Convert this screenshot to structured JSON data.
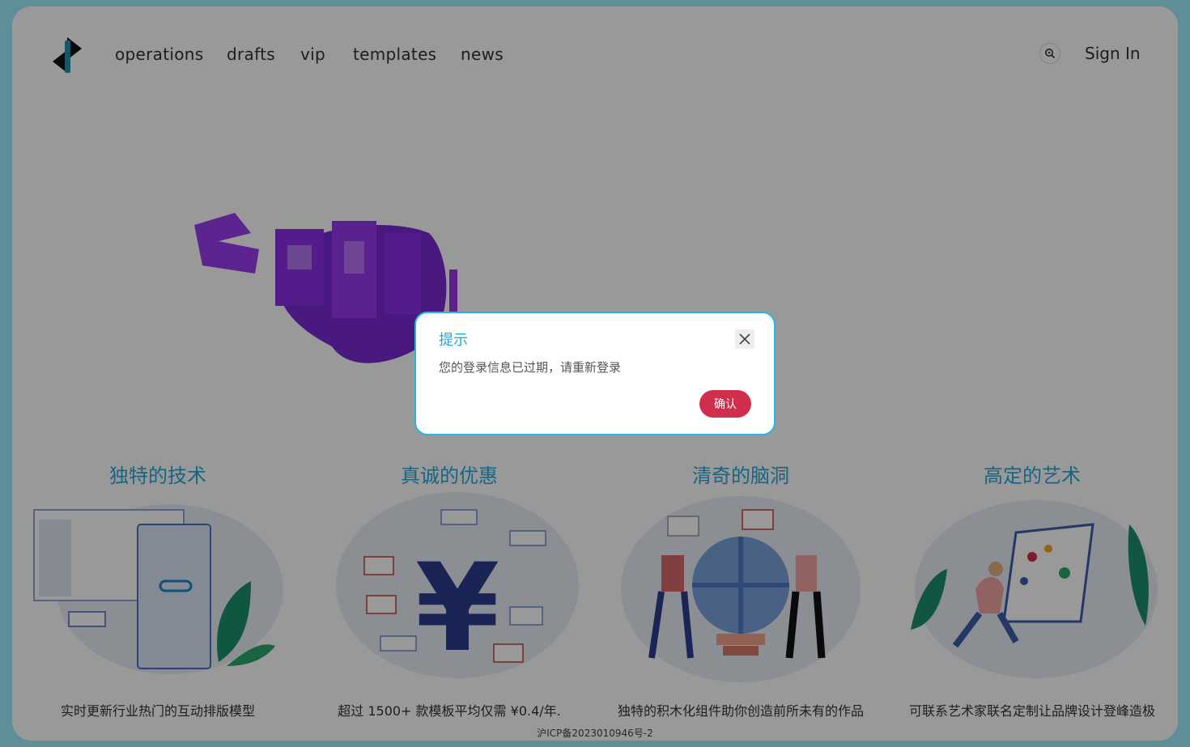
{
  "nav": {
    "items": [
      "operations",
      "drafts",
      "vip",
      "templates",
      "news"
    ],
    "search_icon": "search-icon",
    "signin_label": "Sign In"
  },
  "features": [
    {
      "title": "独特的技术",
      "desc": "实时更新行业热门的互动排版模型"
    },
    {
      "title": "真诚的优惠",
      "desc": "超过 1500+ 款模板平均仅需 ¥0.4/年."
    },
    {
      "title": "清奇的脑洞",
      "desc": "独特的积木化组件助你创造前所未有的作品"
    },
    {
      "title": "高定的艺术",
      "desc": "可联系艺术家联名定制让品牌设计登峰造极"
    }
  ],
  "footer": {
    "icp": "沪ICP备2023010946号-2"
  },
  "dialog": {
    "title": "提示",
    "message": "您的登录信息已过期，请重新登录",
    "confirm_label": "确认",
    "close_icon": "close-icon"
  },
  "colors": {
    "accent": "#2aa9d8",
    "confirm": "#d12e4e",
    "hero_purple": "#7a2bd6",
    "background": "#5e8f96"
  }
}
